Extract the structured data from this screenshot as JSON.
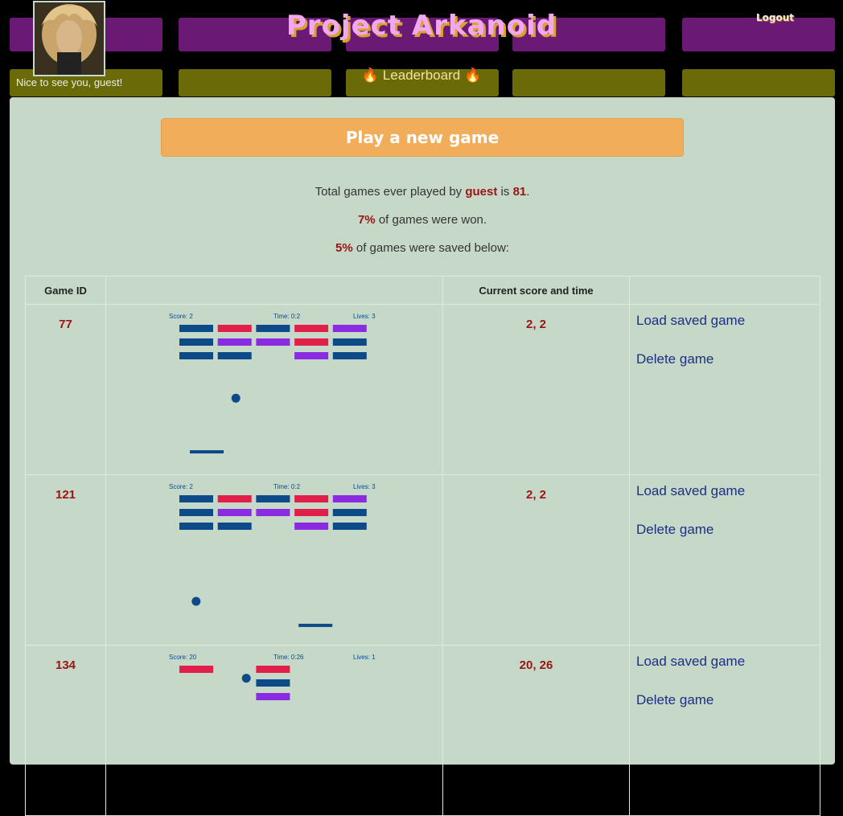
{
  "header": {
    "title": "Project Arkanoid",
    "greeting": "Nice to see you, guest!",
    "leaderboard_label": "Leaderboard",
    "flame_icon": "🔥",
    "logout_label": "Logout"
  },
  "main": {
    "play_button_label": "Play a new game",
    "stats": {
      "total_prefix": "Total games ever played by",
      "user": "guest",
      "total_mid": "is",
      "total_count": "81",
      "total_suffix": ".",
      "won_percent": "7%",
      "won_suffix": "of games were won.",
      "saved_percent": "5%",
      "saved_suffix": "of games were saved below:"
    },
    "table": {
      "headers": [
        "Game ID",
        "",
        "Current score and time",
        ""
      ],
      "load_label": "Load saved game",
      "delete_label": "Delete game",
      "rows": [
        {
          "id": "77",
          "score_time": "2, 2",
          "preview": {
            "score": "Score: 2",
            "time": "Time: 0:2",
            "lives": "Lives: 3",
            "bricks": [
              [
                "blue",
                "red",
                "blue",
                "red",
                "purple"
              ],
              [
                "blue",
                "purple",
                "purple",
                "red",
                "blue"
              ],
              [
                "blue",
                "blue",
                "",
                "purple",
                "blue"
              ]
            ],
            "ball": [
              0.32,
              0.45
            ],
            "paddle": [
              0.1,
              0.83
            ]
          }
        },
        {
          "id": "121",
          "score_time": "2, 2",
          "preview": {
            "score": "Score: 2",
            "time": "Time: 0:2",
            "lives": "Lives: 3",
            "bricks": [
              [
                "blue",
                "red",
                "blue",
                "red",
                "purple"
              ],
              [
                "blue",
                "purple",
                "purple",
                "red",
                "blue"
              ],
              [
                "blue",
                "blue",
                "",
                "purple",
                "blue"
              ]
            ],
            "ball": [
              0.13,
              0.66
            ],
            "paddle": [
              0.62,
              0.85
            ]
          }
        },
        {
          "id": "134",
          "score_time": "20, 26",
          "preview": {
            "score": "Score: 20",
            "time": "Time: 0:26",
            "lives": "Lives: 1",
            "bricks": [
              [
                "red",
                "",
                "red",
                "",
                ""
              ],
              [
                "",
                "",
                "blue",
                "",
                ""
              ],
              [
                "",
                "",
                "purple",
                "",
                ""
              ]
            ],
            "ball": [
              0.37,
              0.06
            ],
            "paddle": null
          }
        }
      ]
    }
  },
  "colors": {
    "panel": "#c6d8c7",
    "brick_blue": "#0d4a8a",
    "brick_red": "#e01f4b",
    "brick_purple": "#8a2be2",
    "accent_red": "#9b1414",
    "link_blue": "#1c2f84",
    "button_orange": "#f2ad5b"
  }
}
